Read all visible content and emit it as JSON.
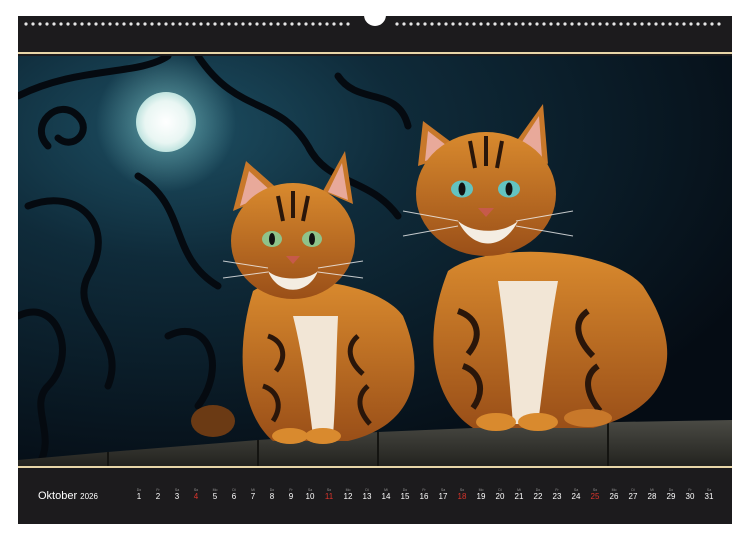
{
  "calendar": {
    "month_label": "Oktober",
    "year_label": "2026",
    "colors": {
      "frame": "#1c1b1d",
      "accent_line": "#e8d6a8",
      "sunday": "#d9342b",
      "text": "#ffffff"
    },
    "days": [
      {
        "wd": "Do",
        "d": "1"
      },
      {
        "wd": "Fr",
        "d": "2"
      },
      {
        "wd": "Sa",
        "d": "3"
      },
      {
        "wd": "So",
        "d": "4"
      },
      {
        "wd": "Mo",
        "d": "5"
      },
      {
        "wd": "Di",
        "d": "6"
      },
      {
        "wd": "Mi",
        "d": "7"
      },
      {
        "wd": "Do",
        "d": "8"
      },
      {
        "wd": "Fr",
        "d": "9"
      },
      {
        "wd": "Sa",
        "d": "10"
      },
      {
        "wd": "So",
        "d": "11"
      },
      {
        "wd": "Mo",
        "d": "12"
      },
      {
        "wd": "Di",
        "d": "13"
      },
      {
        "wd": "Mi",
        "d": "14"
      },
      {
        "wd": "Do",
        "d": "15"
      },
      {
        "wd": "Fr",
        "d": "16"
      },
      {
        "wd": "Sa",
        "d": "17"
      },
      {
        "wd": "So",
        "d": "18"
      },
      {
        "wd": "Mo",
        "d": "19"
      },
      {
        "wd": "Di",
        "d": "20"
      },
      {
        "wd": "Mi",
        "d": "21"
      },
      {
        "wd": "Do",
        "d": "22"
      },
      {
        "wd": "Fr",
        "d": "23"
      },
      {
        "wd": "Sa",
        "d": "24"
      },
      {
        "wd": "So",
        "d": "25"
      },
      {
        "wd": "Mo",
        "d": "26"
      },
      {
        "wd": "Di",
        "d": "27"
      },
      {
        "wd": "Mi",
        "d": "28"
      },
      {
        "wd": "Do",
        "d": "29"
      },
      {
        "wd": "Fr",
        "d": "30"
      },
      {
        "wd": "Sa",
        "d": "31"
      }
    ]
  }
}
